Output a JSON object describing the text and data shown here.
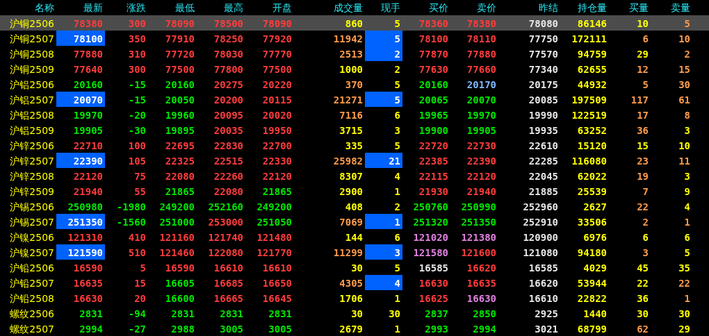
{
  "columns": [
    "名称",
    "最新",
    "涨跌",
    "最低",
    "最高",
    "开盘",
    "成交量",
    "现手",
    "买价",
    "卖价",
    "昨结",
    "持仓量",
    "买量",
    "卖量"
  ],
  "rows": [
    {
      "name": "沪铜2506",
      "selected": true,
      "latest_flash": false,
      "hand_flash": false,
      "cells": [
        {
          "text": "78380",
          "color": "#ff3c3c"
        },
        {
          "text": "300",
          "color": "#ff3c3c"
        },
        {
          "text": "78090",
          "color": "#ff3c3c"
        },
        {
          "text": "78500",
          "color": "#ff3c3c"
        },
        {
          "text": "78090",
          "color": "#ff3c3c"
        },
        {
          "text": "860",
          "color": "#ffff00"
        },
        {
          "text": "5",
          "color": "#ffff00"
        },
        {
          "text": "78360",
          "color": "#ff3c3c"
        },
        {
          "text": "78380",
          "color": "#ff3c3c"
        },
        {
          "text": "78080",
          "color": "#e6e6e6"
        },
        {
          "text": "86146",
          "color": "#ffff00"
        },
        {
          "text": "10",
          "color": "#ffff00"
        },
        {
          "text": "5",
          "color": "#ff9c4c"
        }
      ]
    },
    {
      "name": "沪铜2507",
      "selected": false,
      "latest_flash": true,
      "hand_flash": true,
      "cells": [
        {
          "text": "78100",
          "color": "#ffffff"
        },
        {
          "text": "350",
          "color": "#ff3c3c"
        },
        {
          "text": "77910",
          "color": "#ff3c3c"
        },
        {
          "text": "78250",
          "color": "#ff3c3c"
        },
        {
          "text": "77920",
          "color": "#ff3c3c"
        },
        {
          "text": "11942",
          "color": "#ff9c4c"
        },
        {
          "text": "5",
          "color": "#ffffff"
        },
        {
          "text": "78100",
          "color": "#ff3c3c"
        },
        {
          "text": "78110",
          "color": "#ff3c3c"
        },
        {
          "text": "77750",
          "color": "#e6e6e6"
        },
        {
          "text": "172111",
          "color": "#ffff00"
        },
        {
          "text": "6",
          "color": "#ff9c4c"
        },
        {
          "text": "10",
          "color": "#ff9c4c"
        }
      ]
    },
    {
      "name": "沪铜2508",
      "selected": false,
      "latest_flash": false,
      "hand_flash": true,
      "cells": [
        {
          "text": "77880",
          "color": "#ff3c3c"
        },
        {
          "text": "310",
          "color": "#ff3c3c"
        },
        {
          "text": "77720",
          "color": "#ff3c3c"
        },
        {
          "text": "78030",
          "color": "#ff3c3c"
        },
        {
          "text": "77770",
          "color": "#ff3c3c"
        },
        {
          "text": "2513",
          "color": "#ff9c4c"
        },
        {
          "text": "2",
          "color": "#ffffff"
        },
        {
          "text": "77870",
          "color": "#ff3c3c"
        },
        {
          "text": "77880",
          "color": "#ff3c3c"
        },
        {
          "text": "77570",
          "color": "#e6e6e6"
        },
        {
          "text": "94759",
          "color": "#ffff00"
        },
        {
          "text": "29",
          "color": "#ffff00"
        },
        {
          "text": "2",
          "color": "#ff9c4c"
        }
      ]
    },
    {
      "name": "沪铜2509",
      "selected": false,
      "latest_flash": false,
      "hand_flash": false,
      "cells": [
        {
          "text": "77640",
          "color": "#ff3c3c"
        },
        {
          "text": "300",
          "color": "#ff3c3c"
        },
        {
          "text": "77500",
          "color": "#ff3c3c"
        },
        {
          "text": "77800",
          "color": "#ff3c3c"
        },
        {
          "text": "77500",
          "color": "#ff3c3c"
        },
        {
          "text": "1000",
          "color": "#ffff00"
        },
        {
          "text": "2",
          "color": "#ffff00"
        },
        {
          "text": "77630",
          "color": "#ff3c3c"
        },
        {
          "text": "77660",
          "color": "#ff3c3c"
        },
        {
          "text": "77340",
          "color": "#e6e6e6"
        },
        {
          "text": "62655",
          "color": "#ffff00"
        },
        {
          "text": "12",
          "color": "#ff9c4c"
        },
        {
          "text": "15",
          "color": "#ff9c4c"
        }
      ]
    },
    {
      "name": "沪铝2506",
      "selected": false,
      "latest_flash": false,
      "hand_flash": false,
      "cells": [
        {
          "text": "20160",
          "color": "#00e600"
        },
        {
          "text": "-15",
          "color": "#00e600"
        },
        {
          "text": "20160",
          "color": "#00e600"
        },
        {
          "text": "20275",
          "color": "#ff3c3c"
        },
        {
          "text": "20220",
          "color": "#ff3c3c"
        },
        {
          "text": "370",
          "color": "#ff9c4c"
        },
        {
          "text": "5",
          "color": "#ffff00"
        },
        {
          "text": "20160",
          "color": "#00e600"
        },
        {
          "text": "20170",
          "color": "#80b8ff"
        },
        {
          "text": "20175",
          "color": "#e6e6e6"
        },
        {
          "text": "44932",
          "color": "#ffff00"
        },
        {
          "text": "5",
          "color": "#ff9c4c"
        },
        {
          "text": "30",
          "color": "#ff9c4c"
        }
      ]
    },
    {
      "name": "沪铝2507",
      "selected": false,
      "latest_flash": true,
      "hand_flash": true,
      "cells": [
        {
          "text": "20070",
          "color": "#ffffff"
        },
        {
          "text": "-15",
          "color": "#00e600"
        },
        {
          "text": "20050",
          "color": "#00e600"
        },
        {
          "text": "20200",
          "color": "#ff3c3c"
        },
        {
          "text": "20115",
          "color": "#ff3c3c"
        },
        {
          "text": "21271",
          "color": "#ff9c4c"
        },
        {
          "text": "5",
          "color": "#ffffff"
        },
        {
          "text": "20065",
          "color": "#00e600"
        },
        {
          "text": "20070",
          "color": "#00e600"
        },
        {
          "text": "20085",
          "color": "#e6e6e6"
        },
        {
          "text": "197509",
          "color": "#ffff00"
        },
        {
          "text": "117",
          "color": "#ff9c4c"
        },
        {
          "text": "61",
          "color": "#ff9c4c"
        }
      ]
    },
    {
      "name": "沪铝2508",
      "selected": false,
      "latest_flash": false,
      "hand_flash": false,
      "cells": [
        {
          "text": "19970",
          "color": "#00e600"
        },
        {
          "text": "-20",
          "color": "#00e600"
        },
        {
          "text": "19960",
          "color": "#00e600"
        },
        {
          "text": "20095",
          "color": "#ff3c3c"
        },
        {
          "text": "20020",
          "color": "#ff3c3c"
        },
        {
          "text": "7116",
          "color": "#ff9c4c"
        },
        {
          "text": "6",
          "color": "#ffff00"
        },
        {
          "text": "19965",
          "color": "#00e600"
        },
        {
          "text": "19970",
          "color": "#00e600"
        },
        {
          "text": "19990",
          "color": "#e6e6e6"
        },
        {
          "text": "122519",
          "color": "#ffff00"
        },
        {
          "text": "17",
          "color": "#ff9c4c"
        },
        {
          "text": "8",
          "color": "#ff9c4c"
        }
      ]
    },
    {
      "name": "沪铝2509",
      "selected": false,
      "latest_flash": false,
      "hand_flash": false,
      "cells": [
        {
          "text": "19905",
          "color": "#00e600"
        },
        {
          "text": "-30",
          "color": "#00e600"
        },
        {
          "text": "19895",
          "color": "#00e600"
        },
        {
          "text": "20035",
          "color": "#ff3c3c"
        },
        {
          "text": "19950",
          "color": "#ff3c3c"
        },
        {
          "text": "3715",
          "color": "#ffff00"
        },
        {
          "text": "3",
          "color": "#ffff00"
        },
        {
          "text": "19900",
          "color": "#00e600"
        },
        {
          "text": "19905",
          "color": "#00e600"
        },
        {
          "text": "19935",
          "color": "#e6e6e6"
        },
        {
          "text": "63252",
          "color": "#ffff00"
        },
        {
          "text": "36",
          "color": "#ff9c4c"
        },
        {
          "text": "3",
          "color": "#ffff00"
        }
      ]
    },
    {
      "name": "沪锌2506",
      "selected": false,
      "latest_flash": false,
      "hand_flash": false,
      "cells": [
        {
          "text": "22710",
          "color": "#ff3c3c"
        },
        {
          "text": "100",
          "color": "#ff3c3c"
        },
        {
          "text": "22695",
          "color": "#ff3c3c"
        },
        {
          "text": "22830",
          "color": "#ff3c3c"
        },
        {
          "text": "22700",
          "color": "#ff3c3c"
        },
        {
          "text": "335",
          "color": "#ffff00"
        },
        {
          "text": "5",
          "color": "#ffff00"
        },
        {
          "text": "22720",
          "color": "#ff3c3c"
        },
        {
          "text": "22730",
          "color": "#ff3c3c"
        },
        {
          "text": "22610",
          "color": "#e6e6e6"
        },
        {
          "text": "15120",
          "color": "#ffff00"
        },
        {
          "text": "15",
          "color": "#ffff00"
        },
        {
          "text": "10",
          "color": "#ffff00"
        }
      ]
    },
    {
      "name": "沪锌2507",
      "selected": false,
      "latest_flash": true,
      "hand_flash": true,
      "cells": [
        {
          "text": "22390",
          "color": "#ffffff"
        },
        {
          "text": "105",
          "color": "#ff3c3c"
        },
        {
          "text": "22325",
          "color": "#ff3c3c"
        },
        {
          "text": "22515",
          "color": "#ff3c3c"
        },
        {
          "text": "22330",
          "color": "#ff3c3c"
        },
        {
          "text": "25982",
          "color": "#ff9c4c"
        },
        {
          "text": "21",
          "color": "#ffffff"
        },
        {
          "text": "22385",
          "color": "#ff3c3c"
        },
        {
          "text": "22390",
          "color": "#ff3c3c"
        },
        {
          "text": "22285",
          "color": "#e6e6e6"
        },
        {
          "text": "116080",
          "color": "#ffff00"
        },
        {
          "text": "23",
          "color": "#ff9c4c"
        },
        {
          "text": "11",
          "color": "#ff9c4c"
        }
      ]
    },
    {
      "name": "沪锌2508",
      "selected": false,
      "latest_flash": false,
      "hand_flash": false,
      "cells": [
        {
          "text": "22120",
          "color": "#ff3c3c"
        },
        {
          "text": "75",
          "color": "#ff3c3c"
        },
        {
          "text": "22080",
          "color": "#ff3c3c"
        },
        {
          "text": "22260",
          "color": "#ff3c3c"
        },
        {
          "text": "22120",
          "color": "#ff3c3c"
        },
        {
          "text": "8307",
          "color": "#ffff00"
        },
        {
          "text": "4",
          "color": "#ffff00"
        },
        {
          "text": "22115",
          "color": "#ff3c3c"
        },
        {
          "text": "22120",
          "color": "#ff3c3c"
        },
        {
          "text": "22045",
          "color": "#e6e6e6"
        },
        {
          "text": "62022",
          "color": "#ffff00"
        },
        {
          "text": "19",
          "color": "#ff9c4c"
        },
        {
          "text": "3",
          "color": "#ffff00"
        }
      ]
    },
    {
      "name": "沪锌2509",
      "selected": false,
      "latest_flash": false,
      "hand_flash": false,
      "cells": [
        {
          "text": "21940",
          "color": "#ff3c3c"
        },
        {
          "text": "55",
          "color": "#ff3c3c"
        },
        {
          "text": "21865",
          "color": "#00e600"
        },
        {
          "text": "22080",
          "color": "#ff3c3c"
        },
        {
          "text": "21865",
          "color": "#00e600"
        },
        {
          "text": "2900",
          "color": "#ffff00"
        },
        {
          "text": "1",
          "color": "#ffff00"
        },
        {
          "text": "21930",
          "color": "#ff3c3c"
        },
        {
          "text": "21940",
          "color": "#ff3c3c"
        },
        {
          "text": "21885",
          "color": "#e6e6e6"
        },
        {
          "text": "25539",
          "color": "#ffff00"
        },
        {
          "text": "7",
          "color": "#ff9c4c"
        },
        {
          "text": "9",
          "color": "#ffff00"
        }
      ]
    },
    {
      "name": "沪锡2506",
      "selected": false,
      "latest_flash": false,
      "hand_flash": false,
      "cells": [
        {
          "text": "250980",
          "color": "#00e600"
        },
        {
          "text": "-1980",
          "color": "#00e600"
        },
        {
          "text": "249200",
          "color": "#00e600"
        },
        {
          "text": "252160",
          "color": "#00e600"
        },
        {
          "text": "249200",
          "color": "#00e600"
        },
        {
          "text": "408",
          "color": "#ffff00"
        },
        {
          "text": "2",
          "color": "#ffff00"
        },
        {
          "text": "250760",
          "color": "#00e600"
        },
        {
          "text": "250990",
          "color": "#00e600"
        },
        {
          "text": "252960",
          "color": "#e6e6e6"
        },
        {
          "text": "2627",
          "color": "#ffff00"
        },
        {
          "text": "22",
          "color": "#ff9c4c"
        },
        {
          "text": "4",
          "color": "#ffff00"
        }
      ]
    },
    {
      "name": "沪锡2507",
      "selected": false,
      "latest_flash": true,
      "hand_flash": true,
      "cells": [
        {
          "text": "251350",
          "color": "#ffffff"
        },
        {
          "text": "-1560",
          "color": "#00e600"
        },
        {
          "text": "251000",
          "color": "#00e600"
        },
        {
          "text": "253000",
          "color": "#ff3c3c"
        },
        {
          "text": "251050",
          "color": "#00e600"
        },
        {
          "text": "7069",
          "color": "#ff9c4c"
        },
        {
          "text": "1",
          "color": "#ffffff"
        },
        {
          "text": "251320",
          "color": "#00e600"
        },
        {
          "text": "251350",
          "color": "#00e600"
        },
        {
          "text": "252910",
          "color": "#e6e6e6"
        },
        {
          "text": "33506",
          "color": "#ffff00"
        },
        {
          "text": "2",
          "color": "#ff9c4c"
        },
        {
          "text": "1",
          "color": "#ff9c4c"
        }
      ]
    },
    {
      "name": "沪镍2506",
      "selected": false,
      "latest_flash": false,
      "hand_flash": false,
      "cells": [
        {
          "text": "121310",
          "color": "#ff3c3c"
        },
        {
          "text": "410",
          "color": "#ff3c3c"
        },
        {
          "text": "121160",
          "color": "#ff3c3c"
        },
        {
          "text": "121740",
          "color": "#ff3c3c"
        },
        {
          "text": "121480",
          "color": "#ff3c3c"
        },
        {
          "text": "144",
          "color": "#ffff00"
        },
        {
          "text": "6",
          "color": "#ffff00"
        },
        {
          "text": "121020",
          "color": "#e080e0"
        },
        {
          "text": "121380",
          "color": "#e080e0"
        },
        {
          "text": "120900",
          "color": "#e6e6e6"
        },
        {
          "text": "6976",
          "color": "#ffff00"
        },
        {
          "text": "6",
          "color": "#ffff00"
        },
        {
          "text": "6",
          "color": "#ffff00"
        }
      ]
    },
    {
      "name": "沪镍2507",
      "selected": false,
      "latest_flash": true,
      "hand_flash": true,
      "cells": [
        {
          "text": "121590",
          "color": "#ffffff"
        },
        {
          "text": "510",
          "color": "#ff3c3c"
        },
        {
          "text": "121460",
          "color": "#ff3c3c"
        },
        {
          "text": "122080",
          "color": "#ff3c3c"
        },
        {
          "text": "121770",
          "color": "#ff3c3c"
        },
        {
          "text": "11299",
          "color": "#ff9c4c"
        },
        {
          "text": "3",
          "color": "#ffffff"
        },
        {
          "text": "121580",
          "color": "#e080e0"
        },
        {
          "text": "121600",
          "color": "#ff3c3c"
        },
        {
          "text": "121080",
          "color": "#e6e6e6"
        },
        {
          "text": "94180",
          "color": "#ffff00"
        },
        {
          "text": "3",
          "color": "#ff9c4c"
        },
        {
          "text": "5",
          "color": "#ffff00"
        }
      ]
    },
    {
      "name": "沪铅2506",
      "selected": false,
      "latest_flash": false,
      "hand_flash": false,
      "cells": [
        {
          "text": "16590",
          "color": "#ff3c3c"
        },
        {
          "text": "5",
          "color": "#ff3c3c"
        },
        {
          "text": "16590",
          "color": "#ff3c3c"
        },
        {
          "text": "16610",
          "color": "#ff3c3c"
        },
        {
          "text": "16610",
          "color": "#ff3c3c"
        },
        {
          "text": "30",
          "color": "#ffff00"
        },
        {
          "text": "5",
          "color": "#ffff00"
        },
        {
          "text": "16585",
          "color": "#e6e6e6"
        },
        {
          "text": "16620",
          "color": "#ff3c3c"
        },
        {
          "text": "16585",
          "color": "#e6e6e6"
        },
        {
          "text": "4029",
          "color": "#ffff00"
        },
        {
          "text": "45",
          "color": "#ffff00"
        },
        {
          "text": "35",
          "color": "#ffff00"
        }
      ]
    },
    {
      "name": "沪铅2507",
      "selected": false,
      "latest_flash": false,
      "hand_flash": true,
      "cells": [
        {
          "text": "16635",
          "color": "#ff3c3c"
        },
        {
          "text": "15",
          "color": "#ff3c3c"
        },
        {
          "text": "16605",
          "color": "#00e600"
        },
        {
          "text": "16685",
          "color": "#ff3c3c"
        },
        {
          "text": "16650",
          "color": "#ff3c3c"
        },
        {
          "text": "4305",
          "color": "#ff9c4c"
        },
        {
          "text": "4",
          "color": "#ffffff"
        },
        {
          "text": "16630",
          "color": "#ff3c3c"
        },
        {
          "text": "16635",
          "color": "#ff3c3c"
        },
        {
          "text": "16620",
          "color": "#e6e6e6"
        },
        {
          "text": "53944",
          "color": "#ffff00"
        },
        {
          "text": "22",
          "color": "#ffff00"
        },
        {
          "text": "22",
          "color": "#ff9c4c"
        }
      ]
    },
    {
      "name": "沪铅2508",
      "selected": false,
      "latest_flash": false,
      "hand_flash": false,
      "cells": [
        {
          "text": "16630",
          "color": "#ff3c3c"
        },
        {
          "text": "20",
          "color": "#ff3c3c"
        },
        {
          "text": "16600",
          "color": "#00e600"
        },
        {
          "text": "16665",
          "color": "#ff3c3c"
        },
        {
          "text": "16645",
          "color": "#ff3c3c"
        },
        {
          "text": "1706",
          "color": "#ffff00"
        },
        {
          "text": "1",
          "color": "#ffff00"
        },
        {
          "text": "16625",
          "color": "#ff3c3c"
        },
        {
          "text": "16630",
          "color": "#e080e0"
        },
        {
          "text": "16610",
          "color": "#e6e6e6"
        },
        {
          "text": "22822",
          "color": "#ffff00"
        },
        {
          "text": "36",
          "color": "#ffff00"
        },
        {
          "text": "1",
          "color": "#ff9c4c"
        }
      ]
    },
    {
      "name": "螺纹2506",
      "selected": false,
      "latest_flash": false,
      "hand_flash": false,
      "cells": [
        {
          "text": "2831",
          "color": "#00e600"
        },
        {
          "text": "-94",
          "color": "#00e600"
        },
        {
          "text": "2831",
          "color": "#00e600"
        },
        {
          "text": "2831",
          "color": "#00e600"
        },
        {
          "text": "2831",
          "color": "#00e600"
        },
        {
          "text": "30",
          "color": "#ffff00"
        },
        {
          "text": "30",
          "color": "#ffff00"
        },
        {
          "text": "2837",
          "color": "#00e600"
        },
        {
          "text": "2850",
          "color": "#00e600"
        },
        {
          "text": "2925",
          "color": "#e6e6e6"
        },
        {
          "text": "1440",
          "color": "#ffff00"
        },
        {
          "text": "30",
          "color": "#ffff00"
        },
        {
          "text": "30",
          "color": "#ffff00"
        }
      ]
    },
    {
      "name": "螺纹2507",
      "selected": false,
      "latest_flash": false,
      "hand_flash": false,
      "cells": [
        {
          "text": "2994",
          "color": "#00e600"
        },
        {
          "text": "-27",
          "color": "#00e600"
        },
        {
          "text": "2988",
          "color": "#00e600"
        },
        {
          "text": "3005",
          "color": "#00e600"
        },
        {
          "text": "3005",
          "color": "#00e600"
        },
        {
          "text": "2679",
          "color": "#ffff00"
        },
        {
          "text": "1",
          "color": "#ffff00"
        },
        {
          "text": "2993",
          "color": "#00e600"
        },
        {
          "text": "2994",
          "color": "#00e600"
        },
        {
          "text": "3021",
          "color": "#e6e6e6"
        },
        {
          "text": "68799",
          "color": "#ffff00"
        },
        {
          "text": "62",
          "color": "#ff9c4c"
        },
        {
          "text": "29",
          "color": "#ffff00"
        }
      ]
    }
  ]
}
